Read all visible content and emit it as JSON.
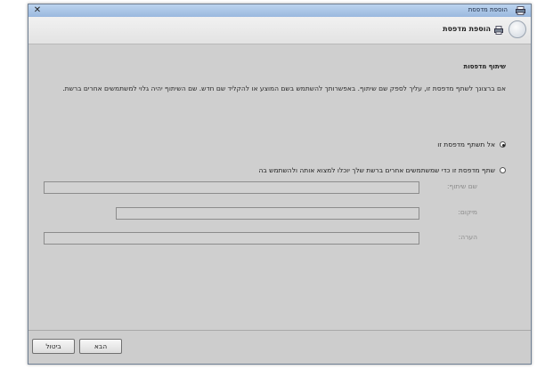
{
  "window": {
    "title": "הוספת מדפסת",
    "close_glyph": "✕"
  },
  "header": {
    "title": "הוספת מדפסת"
  },
  "section": {
    "title": "שיתוף מדפסות",
    "description": "אם ברצונך לשתף מדפסת זו, עליך לספק שם שיתוף. באפשרותך להשתמש בשם המוצע או להקליד שם חדש. שם השיתוף יהיה גלוי למשתמשים אחרים ברשת."
  },
  "options": {
    "no_share_label": "אל תשתף מדפסת זו",
    "share_label": "שתף מדפסת זו כדי שמשתמשים אחרים ברשת שלך יוכלו למצוא אותה ולהשתמש בה",
    "selected": "no_share"
  },
  "fields": {
    "share_name": {
      "label": "שם שיתוף:",
      "value": ""
    },
    "location": {
      "label": "מיקום:",
      "value": ""
    },
    "comment": {
      "label": "הערה:",
      "value": ""
    }
  },
  "footer": {
    "next_label": "הבא",
    "cancel_label": "ביטול"
  }
}
